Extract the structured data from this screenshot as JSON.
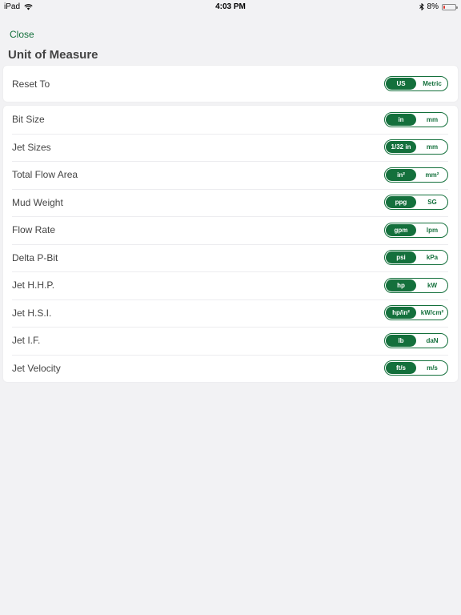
{
  "status_bar": {
    "device": "iPad",
    "time": "4:03 PM",
    "battery": "8%"
  },
  "nav": {
    "close_label": "Close",
    "title": "Unit of Measure"
  },
  "reset": {
    "label": "Reset To",
    "options": [
      "US",
      "Metric"
    ],
    "selected": 0
  },
  "units": [
    {
      "label": "Bit Size",
      "options": [
        "in",
        "mm"
      ],
      "selected": 0
    },
    {
      "label": "Jet Sizes",
      "options": [
        "1/32 in",
        "mm"
      ],
      "selected": 0
    },
    {
      "label": "Total Flow Area",
      "options": [
        "in²",
        "mm²"
      ],
      "selected": 0
    },
    {
      "label": "Mud Weight",
      "options": [
        "ppg",
        "SG"
      ],
      "selected": 0
    },
    {
      "label": "Flow Rate",
      "options": [
        "gpm",
        "lpm"
      ],
      "selected": 0
    },
    {
      "label": "Delta P-Bit",
      "options": [
        "psi",
        "kPa"
      ],
      "selected": 0
    },
    {
      "label": "Jet H.H.P.",
      "options": [
        "hp",
        "kW"
      ],
      "selected": 0
    },
    {
      "label": "Jet H.S.I.",
      "options": [
        "hp/in²",
        "kW/cm²"
      ],
      "selected": 0
    },
    {
      "label": "Jet I.F.",
      "options": [
        "lb",
        "daN"
      ],
      "selected": 0
    },
    {
      "label": "Jet Velocity",
      "options": [
        "ft/s",
        "m/s"
      ],
      "selected": 0
    }
  ],
  "colors": {
    "accent": "#14703c",
    "background": "#f2f2f4",
    "battery_low": "#e0362c"
  }
}
